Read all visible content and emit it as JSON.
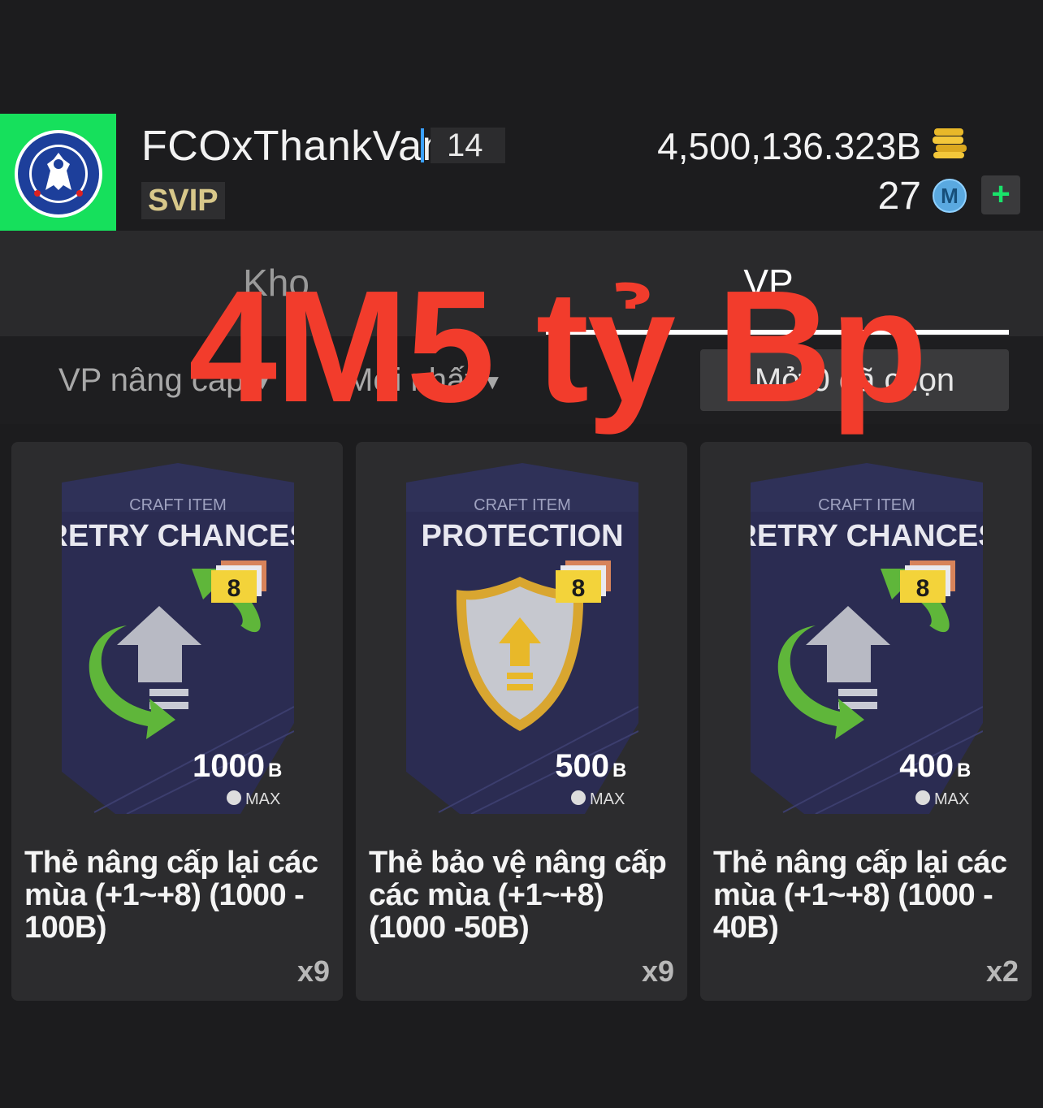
{
  "header": {
    "username": "FCOxThankVan",
    "level": "14",
    "vip_label": "SVIP",
    "bp_amount": "4,500,136.323B",
    "m_amount": "27",
    "m_icon_letter": "M",
    "add_label": "+",
    "club_badge_icon": "chelsea-crest"
  },
  "tabs": [
    {
      "label": "Kho",
      "active": false
    },
    {
      "label": "VP",
      "active": true
    }
  ],
  "filters": {
    "type_label": "VP nâng cấp",
    "sort_label": "Mới nhất",
    "open_button_label": "Mở 0 đã chọn"
  },
  "overlay_caption": "4M5 tỷ Bp",
  "items": [
    {
      "card_header": "CRAFT ITEM",
      "card_title": "RETRY CHANCES",
      "card_level": "8",
      "card_price": "1000",
      "card_price_unit": "B",
      "card_max_label": "MAX",
      "icon": "retry-arrows-icon",
      "name": "Thẻ nâng cấp lại các mùa (+1~+8) (1000 - 100B)",
      "qty": "x9"
    },
    {
      "card_header": "CRAFT ITEM",
      "card_title": "PROTECTION",
      "card_level": "8",
      "card_price": "500",
      "card_price_unit": "B",
      "card_max_label": "MAX",
      "icon": "shield-icon",
      "name": "Thẻ bảo vệ nâng cấp các mùa (+1~+8) (1000 -50B)",
      "qty": "x9"
    },
    {
      "card_header": "CRAFT ITEM",
      "card_title": "RETRY CHANCES",
      "card_level": "8",
      "card_price": "400",
      "card_price_unit": "B",
      "card_max_label": "MAX",
      "icon": "retry-arrows-icon",
      "name": "Thẻ nâng cấp lại các mùa (+1~+8) (1000 - 40B)",
      "qty": "x2"
    }
  ],
  "colors": {
    "badge_bg": "#16e05c",
    "overlay_text": "#f23c2c",
    "card_bg": "#2c2c2e",
    "card_art_bg": "#2b2c52"
  }
}
